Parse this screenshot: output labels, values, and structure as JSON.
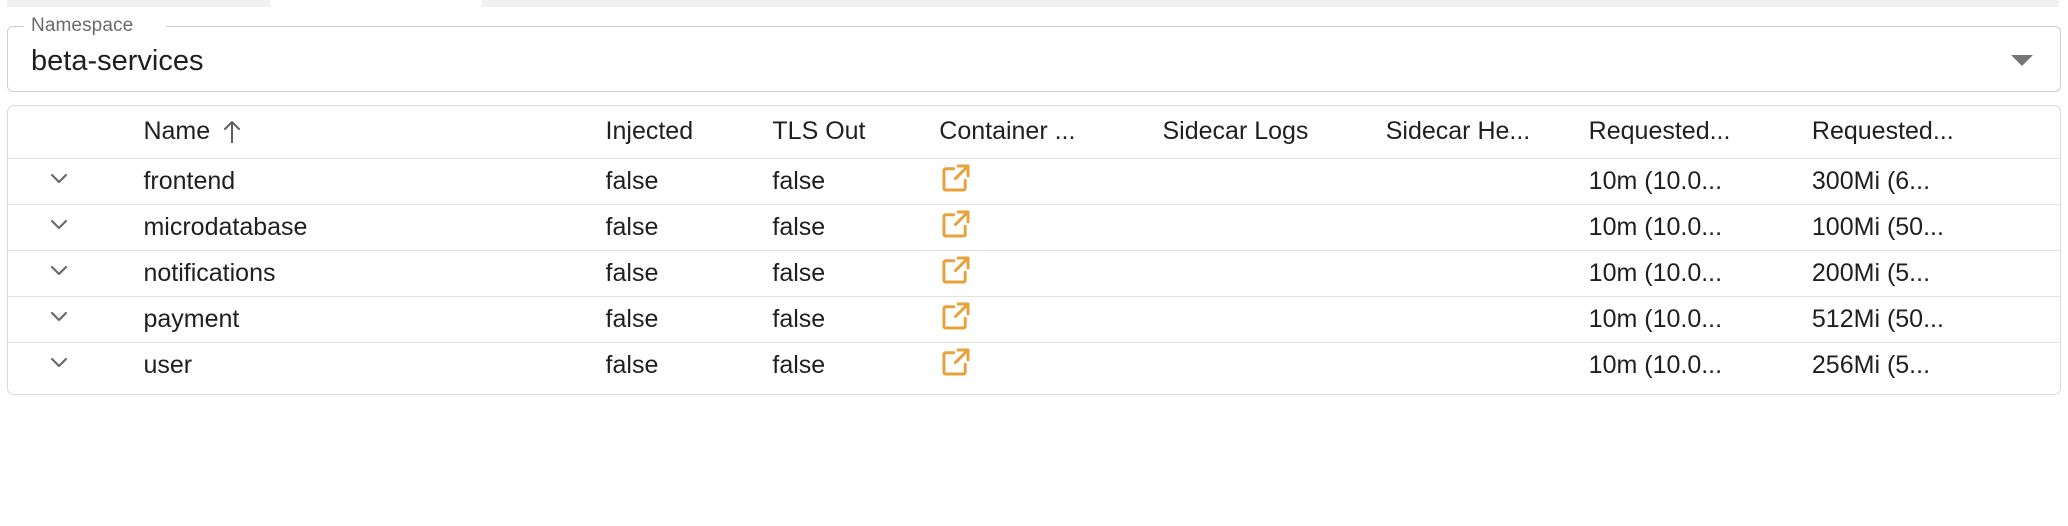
{
  "theme": {
    "accent_orange": "#E8A23C",
    "border": "#d9d9d9",
    "row_border": "#e2e2e2",
    "text": "#1f1f1f",
    "label_gray": "#6b6b6b",
    "icon_gray": "#757575",
    "strip_gray": "#f1f1f1"
  },
  "namespace_select": {
    "label": "Namespace",
    "value": "beta-services",
    "dropdown_icon": "caret-down-icon"
  },
  "table": {
    "sort": {
      "column": "Name",
      "direction": "ascending",
      "icon": "arrow-up-icon"
    },
    "columns": [
      {
        "key": "expand",
        "label": "",
        "name": "column-expand"
      },
      {
        "key": "name",
        "label": "Name",
        "name": "column-name"
      },
      {
        "key": "injected",
        "label": "Injected",
        "name": "column-injected"
      },
      {
        "key": "tls_out",
        "label": "TLS Out",
        "name": "column-tls-out"
      },
      {
        "key": "container",
        "label": "Container ...",
        "name": "column-container"
      },
      {
        "key": "sidecar_logs",
        "label": "Sidecar Logs",
        "name": "column-sidecar-logs"
      },
      {
        "key": "sidecar_health",
        "label": "Sidecar He...",
        "name": "column-sidecar-health"
      },
      {
        "key": "requested_cpu",
        "label": "Requested...",
        "name": "column-requested-cpu"
      },
      {
        "key": "requested_mem",
        "label": "Requested...",
        "name": "column-requested-memory"
      }
    ],
    "rows": [
      {
        "expand_icon": "chevron-down-icon",
        "name": "frontend",
        "injected": "false",
        "tls_out": "false",
        "container_icon": "open-in-new-icon",
        "sidecar_logs": "",
        "sidecar_health": "",
        "requested_cpu": "10m (10.0...",
        "requested_mem": "300Mi (6..."
      },
      {
        "expand_icon": "chevron-down-icon",
        "name": "microdatabase",
        "injected": "false",
        "tls_out": "false",
        "container_icon": "open-in-new-icon",
        "sidecar_logs": "",
        "sidecar_health": "",
        "requested_cpu": "10m (10.0...",
        "requested_mem": "100Mi (50..."
      },
      {
        "expand_icon": "chevron-down-icon",
        "name": "notifications",
        "injected": "false",
        "tls_out": "false",
        "container_icon": "open-in-new-icon",
        "sidecar_logs": "",
        "sidecar_health": "",
        "requested_cpu": "10m (10.0...",
        "requested_mem": "200Mi (5..."
      },
      {
        "expand_icon": "chevron-down-icon",
        "name": "payment",
        "injected": "false",
        "tls_out": "false",
        "container_icon": "open-in-new-icon",
        "sidecar_logs": "",
        "sidecar_health": "",
        "requested_cpu": "10m (10.0...",
        "requested_mem": "512Mi (50..."
      },
      {
        "expand_icon": "chevron-down-icon",
        "name": "user",
        "injected": "false",
        "tls_out": "false",
        "container_icon": "open-in-new-icon",
        "sidecar_logs": "",
        "sidecar_health": "",
        "requested_cpu": "10m (10.0...",
        "requested_mem": "256Mi (5..."
      }
    ]
  }
}
